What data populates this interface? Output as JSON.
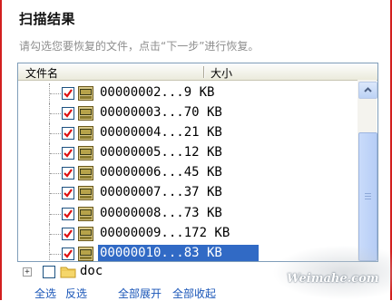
{
  "dialog": {
    "title": "扫描结果",
    "subtitle": "请勾选您要恢复的文件，点击“下一步”进行恢复。"
  },
  "list": {
    "columns": {
      "name": "文件名",
      "size": "大小"
    },
    "rows": [
      {
        "text": "00000002...9 KB",
        "checked": true,
        "selected": false
      },
      {
        "text": "00000003...70 KB",
        "checked": true,
        "selected": false
      },
      {
        "text": "00000004...21 KB",
        "checked": true,
        "selected": false
      },
      {
        "text": "00000005...12 KB",
        "checked": true,
        "selected": false
      },
      {
        "text": "00000006...45 KB",
        "checked": true,
        "selected": false
      },
      {
        "text": "00000007...37 KB",
        "checked": true,
        "selected": false
      },
      {
        "text": "00000008...73 KB",
        "checked": true,
        "selected": false
      },
      {
        "text": "00000009...172 KB",
        "checked": true,
        "selected": false
      },
      {
        "text": "00000010...83 KB",
        "checked": true,
        "selected": true
      }
    ],
    "folder": {
      "label": "doc",
      "checked": false,
      "expand_symbol": "+"
    }
  },
  "actions": {
    "select_all": "全选",
    "invert": "反选",
    "expand_all": "全部展开",
    "collapse_all": "全部收起"
  },
  "watermark": "Weimahe.com",
  "colors": {
    "accent_red": "#d21f1f",
    "selection_blue": "#316ac5",
    "link_blue": "#1a56b8",
    "subtitle_gray": "#8e8e8e"
  }
}
